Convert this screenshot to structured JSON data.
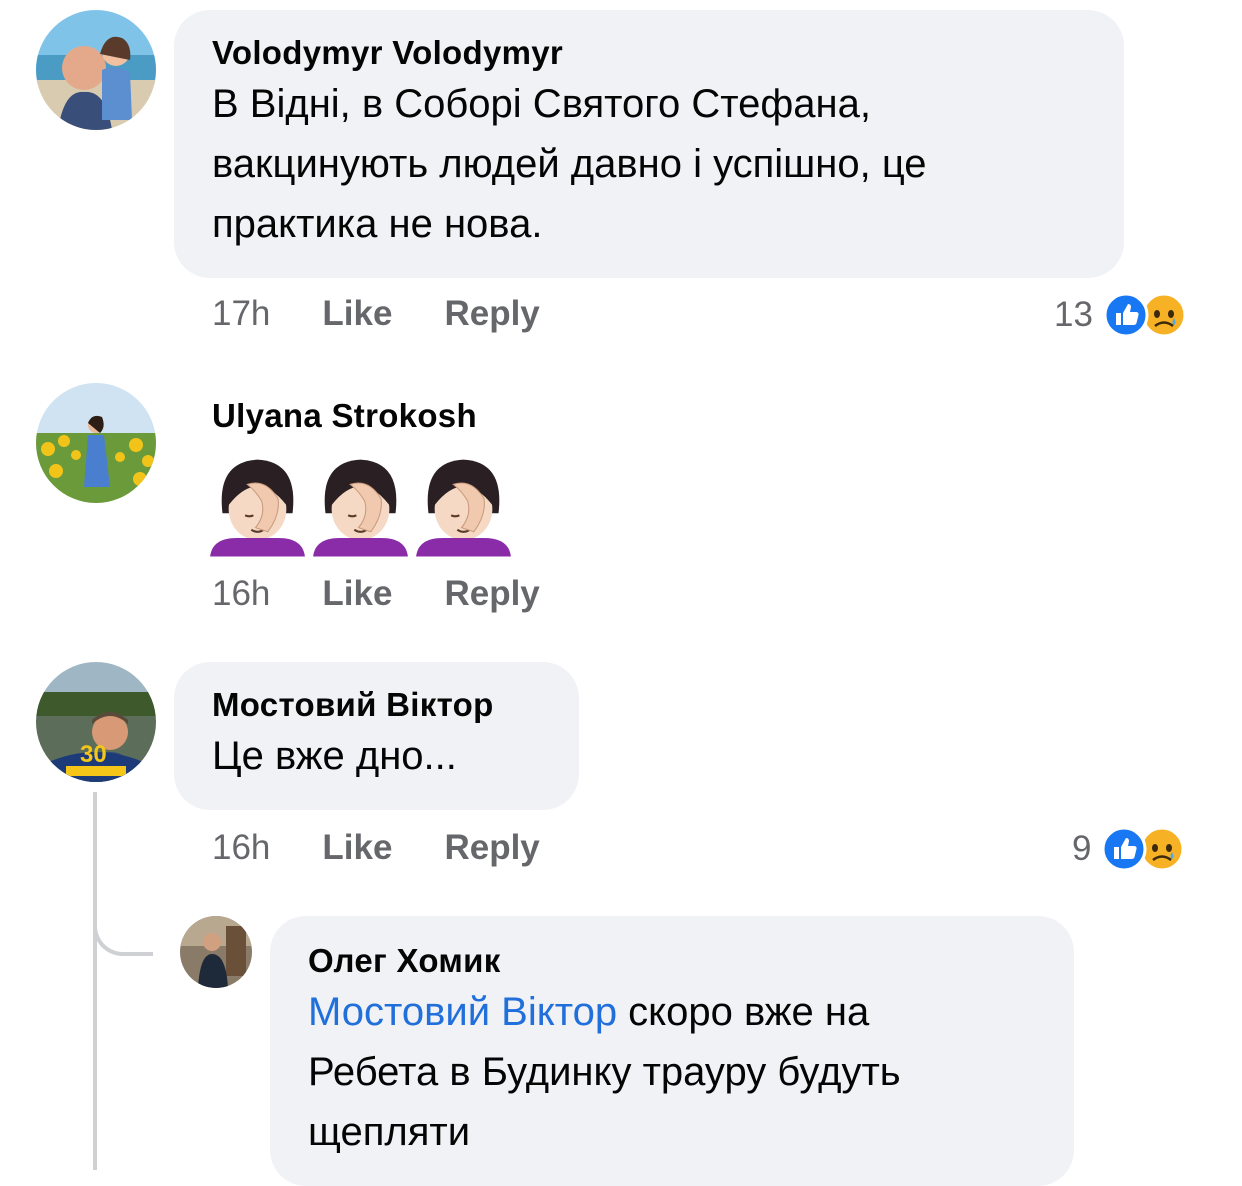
{
  "comments": [
    {
      "author": "Volodymyr Volodymyr",
      "text_lines": [
        "В Відні, в Соборі Святого Стефана,",
        "вакцинують людей давно і успішно, це",
        "практика не нова."
      ],
      "time": "17h",
      "like": "Like",
      "reply": "Reply",
      "reaction_count": "13",
      "reactions": [
        "like-icon",
        "sad-icon"
      ]
    },
    {
      "author": "Ulyana  Strokosh",
      "emoji": "🤦🏻‍♀️🤦🏻‍♀️🤦🏻‍♀️",
      "time": "16h",
      "like": "Like",
      "reply": "Reply"
    },
    {
      "author": "Мостовий Віктор",
      "text": "Це вже дно...",
      "time": "16h",
      "like": "Like",
      "reply": "Reply",
      "reaction_count": "9",
      "reactions": [
        "like-icon",
        "sad-icon"
      ]
    }
  ],
  "reply": {
    "author": "Олег Хомик",
    "mention": "Мостовий Віктор",
    "text_line1": " скоро вже на",
    "text_line2": "Ребета в Будинку трауру будуть",
    "text_line3": "щепляти"
  },
  "colors": {
    "bubble": "#f0f2f5",
    "meta": "#65676b",
    "mention": "#216fdb",
    "like_blue": "#1877f2",
    "sad_yellow": "#f7b125"
  }
}
